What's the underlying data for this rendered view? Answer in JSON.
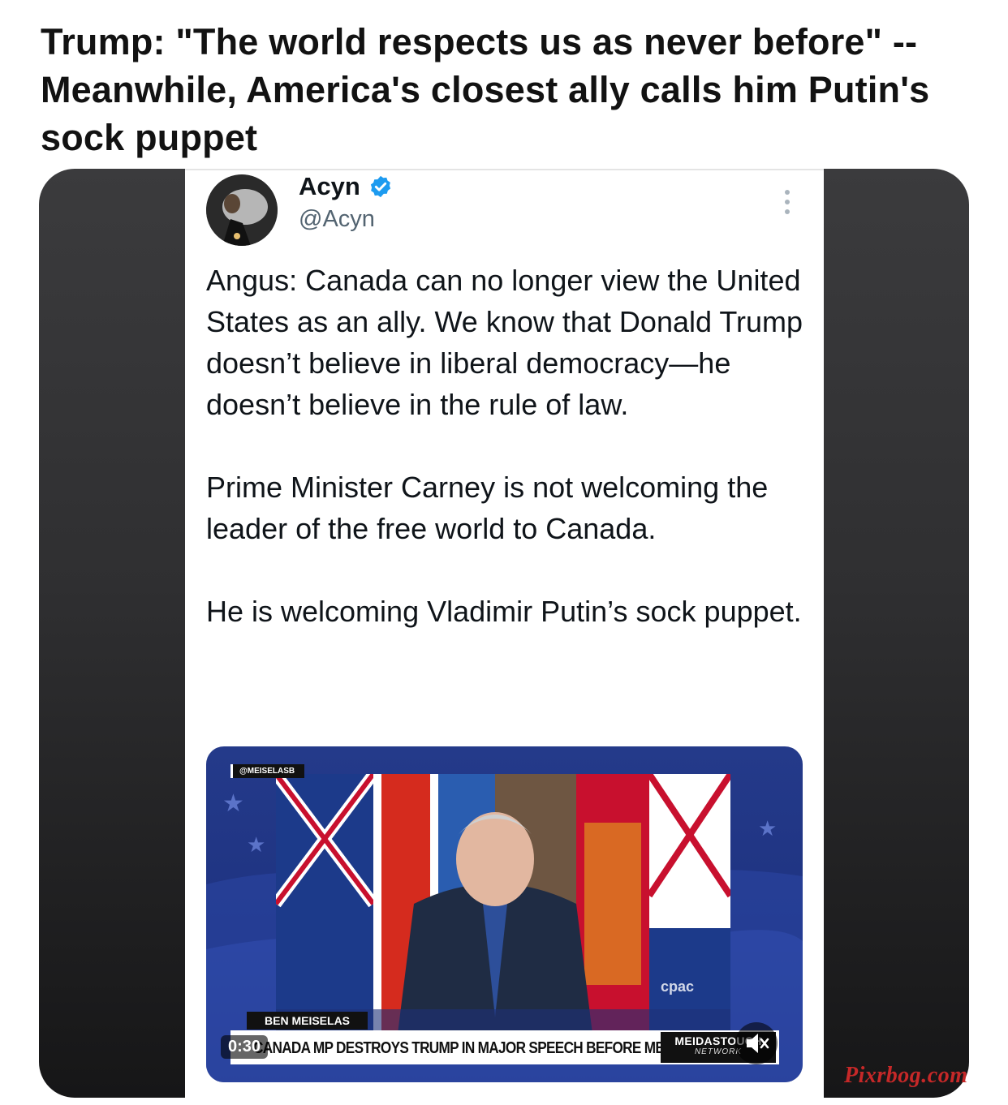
{
  "headline": "Trump: \"The world respects us as never before\" -- Meanwhile, America's closest ally calls him Putin's sock puppet",
  "tweet": {
    "author_name": "Acyn",
    "author_handle": "@Acyn",
    "verified": true,
    "paragraphs": [
      "Angus: Canada can no longer view the United States as an ally. We know that Donald Trump doesn’t believe in liberal democracy—he doesn’t believe in the rule of law.",
      "Prime Minister Carney is not welcoming the leader of the free world to Canada.",
      "He is welcoming Vladimir Putin’s sock puppet."
    ],
    "video": {
      "source_tag": "@MEISELASB",
      "speaker_name": "BEN MEISELAS",
      "lower_headline": "CANADA MP DESTROYS TRUMP IN MAJOR SPEECH BEFORE MEETING",
      "brand_line1": "MEIDASTOUCH",
      "brand_line2": "NETWORK",
      "broadcaster": "cpac",
      "duration": "0:30"
    }
  },
  "watermark": "Pixrbog.com",
  "icons": [
    "verified-badge-icon",
    "more-options-icon",
    "mute-icon"
  ],
  "colors": {
    "verified": "#1d9bf0",
    "watermark": "#c62828"
  }
}
